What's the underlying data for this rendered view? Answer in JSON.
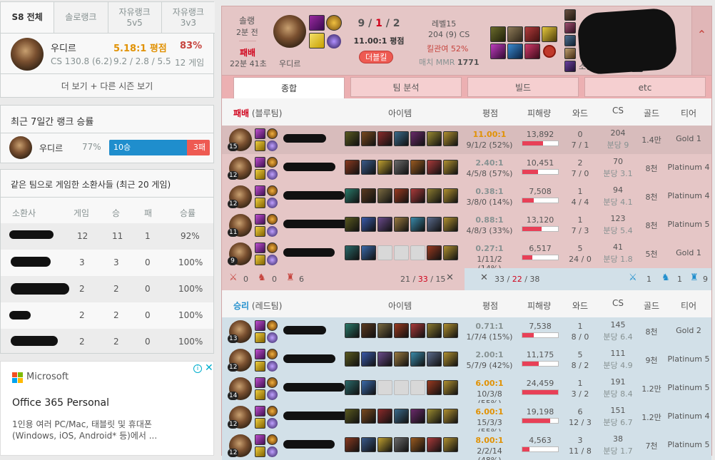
{
  "season_tabs": [
    {
      "l1": "S8 전체",
      "l2": ""
    },
    {
      "l1": "솔로랭크",
      "l2": ""
    },
    {
      "l1": "자유랭크",
      "l2": "5v5"
    },
    {
      "l1": "자유랭크",
      "l2": "3v3"
    }
  ],
  "champ_summary": {
    "name": "우디르",
    "cs": "CS 130.8 (6.2)",
    "ratio": "5.18:1 평점",
    "kda": "9.2 / 2.8 / 5.5",
    "winrate": "83%",
    "games": "12 게임",
    "more": "더 보기 + 다른 시즌 보기"
  },
  "recent": {
    "title": "최근 7일간 랭크 승률",
    "champ": "우디르",
    "pct": "77%",
    "wins": "10승",
    "losses": "3패",
    "win_frac": 0.77
  },
  "together": {
    "title": "같은 팀으로 게임한 소환사들 (최근 20 게임)",
    "headers": [
      "소환사",
      "게임",
      "승",
      "패",
      "승률"
    ],
    "rows": [
      [
        "12",
        "11",
        "1",
        "92%"
      ],
      [
        "3",
        "3",
        "0",
        "100%"
      ],
      [
        "2",
        "2",
        "0",
        "100%"
      ],
      [
        "2",
        "2",
        "0",
        "100%"
      ],
      [
        "2",
        "2",
        "0",
        "100%"
      ]
    ]
  },
  "ad": {
    "brand": "Microsoft",
    "title": "Office 365 Personal",
    "desc": "1인용 여러 PC/Mac, 태블릿 및 휴대폰 (Windows, iOS, Android* 등)에서 ..."
  },
  "game": {
    "mode": "솔랭",
    "ago": "2분 전",
    "result": "패배",
    "duration": "22분 41초",
    "champ": "우디르",
    "kda_k": "9",
    "kda_d": "1",
    "kda_a": "2",
    "ratio": "11.00:1 평점",
    "multikill": "더블킬",
    "level": "레벨15",
    "cs": "204 (9) CS",
    "kp": "킬관여 52%",
    "mmr_label": "매치 MMR",
    "mmr": "1771",
    "player_stub": "소환사"
  },
  "detail_tabs": [
    "종합",
    "팀 분석",
    "빌드",
    "etc"
  ],
  "blue": {
    "result": "패배",
    "team": "(블루팀)",
    "cols": [
      "아이템",
      "평점",
      "피해량",
      "와드",
      "CS",
      "골드",
      "티어"
    ],
    "players": [
      {
        "lvl": "15",
        "ratio": "11.00:1",
        "kda": "9/1/2 (52%)",
        "dmg": "13,892",
        "dfrac": 0.57,
        "w1": "0",
        "w2": "7 / 1",
        "cs": "204",
        "cspm": "분당 9",
        "gold": "1.4만",
        "tier": "Gold 1",
        "hi": true
      },
      {
        "lvl": "12",
        "ratio": "2.40:1",
        "kda": "4/5/8 (57%)",
        "dmg": "10,451",
        "dfrac": 0.43,
        "w1": "2",
        "w2": "7 / 0",
        "cs": "70",
        "cspm": "분당 3.1",
        "gold": "8천",
        "tier": "Platinum 4"
      },
      {
        "lvl": "12",
        "ratio": "0.38:1",
        "kda": "3/8/0 (14%)",
        "dmg": "7,508",
        "dfrac": 0.31,
        "w1": "1",
        "w2": "4 / 4",
        "cs": "94",
        "cspm": "분당 4.1",
        "gold": "8천",
        "tier": "Platinum 4"
      },
      {
        "lvl": "11",
        "ratio": "0.88:1",
        "kda": "4/8/3 (33%)",
        "dmg": "13,120",
        "dfrac": 0.54,
        "w1": "1",
        "w2": "7 / 3",
        "cs": "123",
        "cspm": "분당 5.4",
        "gold": "8천",
        "tier": "Platinum 5"
      },
      {
        "lvl": "9",
        "ratio": "0.27:1",
        "kda": "1/11/2 (14%)",
        "dmg": "6,517",
        "dfrac": 0.27,
        "w1": "5",
        "w2": "24 / 0",
        "cs": "41",
        "cspm": "분당 1.8",
        "gold": "5천",
        "tier": "Gold 1"
      }
    ]
  },
  "summary": {
    "b_baron": "0",
    "b_dragon": "0",
    "b_tower": "6",
    "b_score": "21",
    "b_score_d": "33",
    "b_score_a": "15",
    "r_score": "33",
    "r_score_d": "22",
    "r_score_a": "38",
    "r_baron": "1",
    "r_dragon": "1",
    "r_tower": "9"
  },
  "red": {
    "result": "승리",
    "team": "(레드팀)",
    "players": [
      {
        "lvl": "13",
        "ratio": "0.71:1",
        "kda": "1/7/4 (15%)",
        "dmg": "7,538",
        "dfrac": 0.31,
        "w1": "1",
        "w2": "8 / 0",
        "cs": "145",
        "cspm": "분당 6.4",
        "gold": "8천",
        "tier": "Gold 2"
      },
      {
        "lvl": "12",
        "ratio": "2.00:1",
        "kda": "5/7/9 (42%)",
        "dmg": "11,175",
        "dfrac": 0.46,
        "w1": "5",
        "w2": "8 / 2",
        "cs": "111",
        "cspm": "분당 4.9",
        "gold": "9천",
        "tier": "Platinum 5"
      },
      {
        "lvl": "14",
        "ratio": "6.00:1",
        "kda": "10/3/8 (55%)",
        "dmg": "24,459",
        "dfrac": 1.0,
        "w1": "1",
        "w2": "3 / 2",
        "cs": "191",
        "cspm": "분당 8.4",
        "gold": "1.2만",
        "tier": "Platinum 5"
      },
      {
        "lvl": "12",
        "ratio": "6.00:1",
        "kda": "15/3/3 (55%)",
        "dmg": "19,198",
        "dfrac": 0.78,
        "w1": "6",
        "w2": "12 / 3",
        "cs": "151",
        "cspm": "분당 6.7",
        "gold": "1.2만",
        "tier": "Platinum 4"
      },
      {
        "lvl": "12",
        "ratio": "8.00:1",
        "kda": "2/2/14 (48%)",
        "dmg": "4,563",
        "dfrac": 0.19,
        "w1": "3",
        "w2": "11 / 8",
        "cs": "38",
        "cspm": "분당 1.7",
        "gold": "7천",
        "tier": "Platinum 5"
      }
    ]
  },
  "colors": {
    "loss_bg": "#e5c6c6",
    "loss_head": "#f5d0d0",
    "win_bg": "#d2e0e8",
    "win_row": "#cadfe8",
    "accent": "#d13639",
    "blue": "#1f8ecd",
    "orange": "#e19205"
  }
}
